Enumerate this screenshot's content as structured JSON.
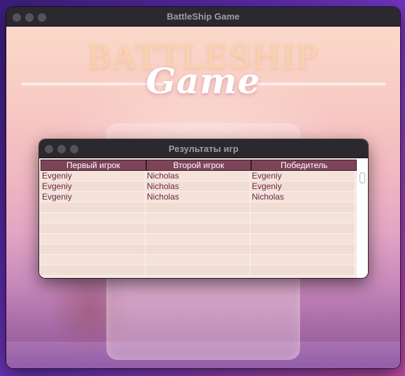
{
  "main_window": {
    "title": "BattleShip Game",
    "logo_top": "BATTLESHIP",
    "logo_bottom": "Game"
  },
  "dialog": {
    "title": "Результаты игр",
    "columns": [
      "Первый игрок",
      "Второй игрок",
      "Победитель"
    ],
    "rows": [
      [
        "Evgeniy",
        "Nicholas",
        "Evgeniy"
      ],
      [
        "Evgeniy",
        "Nicholas",
        "Evgeniy"
      ],
      [
        "Evgeniy",
        "Nicholas",
        "Nicholas"
      ],
      [
        "",
        "",
        ""
      ],
      [
        "",
        "",
        ""
      ],
      [
        "",
        "",
        ""
      ],
      [
        "",
        "",
        ""
      ],
      [
        "",
        "",
        ""
      ],
      [
        "",
        "",
        ""
      ],
      [
        "",
        "",
        ""
      ]
    ]
  },
  "colors": {
    "header_bg": "#7d4459",
    "cell_text": "#6a2a44",
    "titlebar": "#2b2830"
  }
}
